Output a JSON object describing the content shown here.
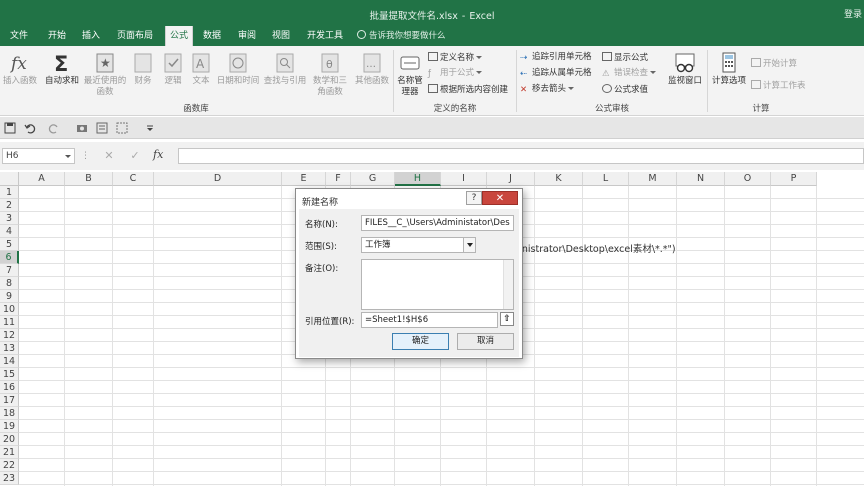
{
  "window": {
    "title_file": "批量提取文件名.xlsx",
    "title_sep": "-",
    "title_app": "Excel",
    "corner": "登录"
  },
  "tabs": [
    {
      "label": "文件"
    },
    {
      "label": "开始"
    },
    {
      "label": "插入"
    },
    {
      "label": "页面布局"
    },
    {
      "label": "公式",
      "active": true
    },
    {
      "label": "数据"
    },
    {
      "label": "审阅"
    },
    {
      "label": "视图"
    },
    {
      "label": "开发工具"
    }
  ],
  "tellme": "告诉我你想要做什么",
  "ribbon": {
    "insert_function": "插入函数",
    "autosum": "自动求和",
    "recent": "最近使用的函数",
    "financial": "财务",
    "logical": "逻辑",
    "text": "文本",
    "datetime": "日期和时间",
    "lookup": "查找与引用",
    "math": "数学和三角函数",
    "other": "其他函数",
    "group_library": "函数库",
    "name_manager": "名称管理器",
    "define_name": "定义名称",
    "use_in_formula": "用于公式",
    "create_from_selection": "根据所选内容创建",
    "group_names": "定义的名称",
    "trace_precedents": "追踪引用单元格",
    "trace_dependents": "追踪从属单元格",
    "remove_arrows": "移去箭头",
    "show_formulas": "显示公式",
    "error_checking": "错误检查",
    "evaluate_formula": "公式求值",
    "group_audit": "公式审核",
    "watch_window": "监视窗口",
    "calc_options": "计算选项",
    "calc_now": "开始计算",
    "calc_sheet": "计算工作表",
    "group_calc": "计算"
  },
  "formula_bar": {
    "name_box": "H6",
    "cancel": "✕",
    "enter": "✓",
    "fx": "fx"
  },
  "grid": {
    "columns": [
      "A",
      "B",
      "C",
      "D",
      "E",
      "F",
      "G",
      "H",
      "I",
      "J",
      "K",
      "L",
      "M",
      "N",
      "O",
      "P"
    ],
    "rows": [
      "1",
      "2",
      "3",
      "4",
      "5",
      "6",
      "7",
      "8",
      "9",
      "10",
      "11",
      "12",
      "13",
      "14",
      "15",
      "16",
      "17",
      "18",
      "19",
      "20",
      "21",
      "22",
      "23"
    ],
    "selected_col": "H",
    "selected_row": "6",
    "cell_overflow_text": "ministrator\\Desktop\\excel素材\\*.*\")"
  },
  "dialog": {
    "title": "新建名称",
    "help": "?",
    "close": "✕",
    "name_label": "名称(N):",
    "name_value": "FILES__C_\\Users\\Administ​ator\\Des",
    "scope_label": "范围(S):",
    "scope_value": "工作簿",
    "comment_label": "备注(O):",
    "comment_value": "",
    "refers_label": "引用位置(R):",
    "refers_value": "=Sheet1!$H$6",
    "ok": "确定",
    "cancel": "取消"
  }
}
